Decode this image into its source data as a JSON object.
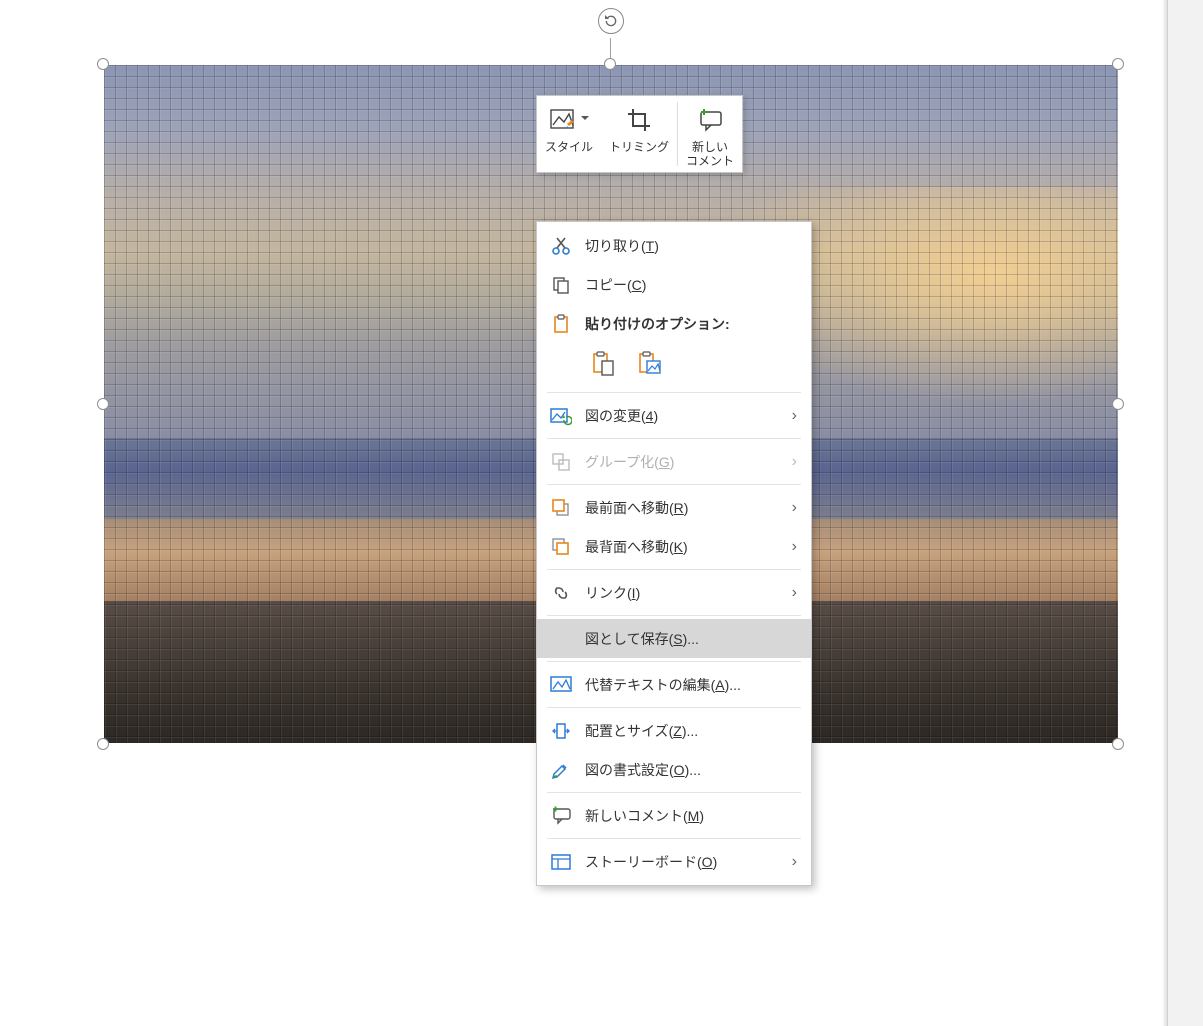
{
  "mini_toolbar": {
    "style": "スタイル",
    "crop": "トリミング",
    "new_comment_l1": "新しい",
    "new_comment_l2": "コメント"
  },
  "context_menu": {
    "cut": {
      "label": "切り取り",
      "accel": "T"
    },
    "copy": {
      "label": "コピー",
      "accel": "C"
    },
    "paste_header": {
      "label": "貼り付けのオプション:"
    },
    "change_picture": {
      "label": "図の変更",
      "accel": "4"
    },
    "group": {
      "label": "グループ化",
      "accel": "G"
    },
    "bring_front": {
      "label": "最前面へ移動",
      "accel": "R"
    },
    "send_back": {
      "label": "最背面へ移動",
      "accel": "K"
    },
    "link": {
      "label": "リンク",
      "accel": "I"
    },
    "save_as_pic": {
      "label": "図として保存",
      "accel": "S",
      "suffix": "..."
    },
    "alt_text": {
      "label": "代替テキストの編集",
      "accel": "A",
      "suffix": "..."
    },
    "size_pos": {
      "label": "配置とサイズ",
      "accel": "Z",
      "suffix": "..."
    },
    "format_picture": {
      "label": "図の書式設定",
      "accel": "O",
      "suffix": "..."
    },
    "new_comment": {
      "label": "新しいコメント",
      "accel": "M"
    },
    "storyboard": {
      "label": "ストーリーボード",
      "accel": "O"
    }
  }
}
